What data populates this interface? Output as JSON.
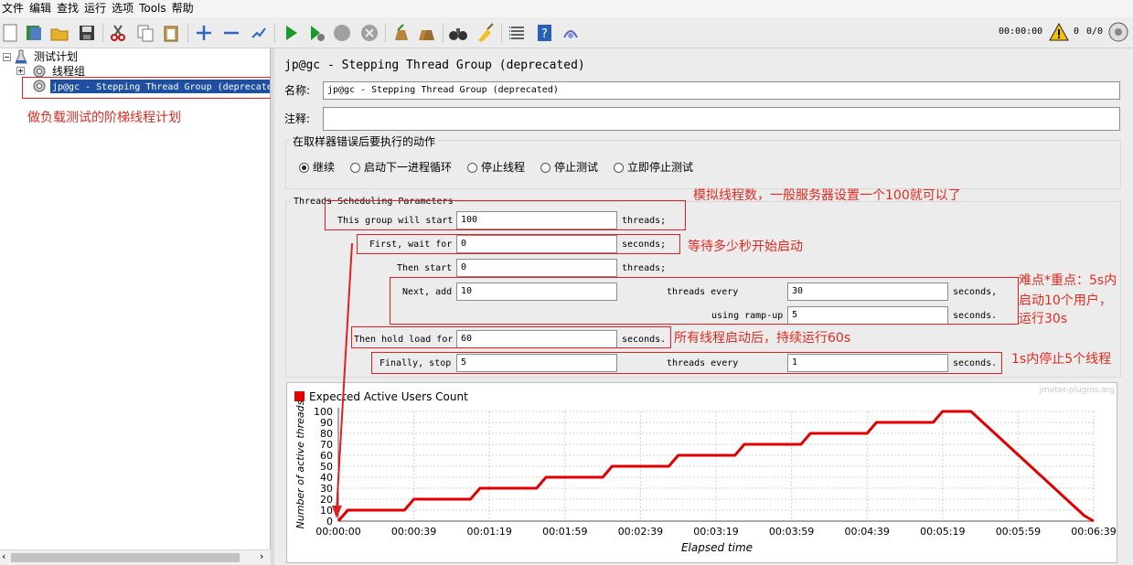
{
  "menu": [
    "文件",
    "编辑",
    "查找",
    "运行",
    "选项",
    "Tools",
    "帮助"
  ],
  "toolbar": {
    "timer": "00:00:00",
    "warning_count": "0",
    "threads_ratio": "0/0"
  },
  "tree": {
    "root": "测试计划",
    "group": "线程组",
    "selected": "jp@gc - Stepping Thread Group (deprecated)"
  },
  "panel": {
    "title": "jp@gc - Stepping Thread Group (deprecated)",
    "name_label": "名称:",
    "name_value": "jp@gc - Stepping Thread Group (deprecated)",
    "comment_label": "注释:",
    "comment_value": "",
    "error_group_title": "在取样器错误后要执行的动作",
    "error_actions": [
      {
        "label": "继续",
        "selected": true
      },
      {
        "label": "启动下一进程循环",
        "selected": false
      },
      {
        "label": "停止线程",
        "selected": false
      },
      {
        "label": "停止测试",
        "selected": false
      },
      {
        "label": "立即停止测试",
        "selected": false
      }
    ],
    "sched_title": "Threads Scheduling Parameters",
    "rows": {
      "start_label": "This group will start",
      "start_value": "100",
      "start_unit": "threads;",
      "wait_label": "First, wait for",
      "wait_value": "0",
      "wait_unit": "seconds;",
      "then_label": "Then start",
      "then_value": "0",
      "then_unit": "threads;",
      "next_label": "Next, add",
      "next_value": "10",
      "next_mid": "threads every",
      "next_every": "30",
      "next_unit": "seconds,",
      "ramp_label": "using ramp-up",
      "ramp_value": "5",
      "ramp_unit": "seconds.",
      "hold_label": "Then hold load for",
      "hold_value": "60",
      "hold_unit": "seconds.",
      "stop_label": "Finally, stop",
      "stop_value": "5",
      "stop_mid": "threads every",
      "stop_every": "1",
      "stop_unit": "seconds."
    }
  },
  "annotations": {
    "plan": "做负载测试的阶梯线程计划",
    "threads": "模拟线程数，一般服务器设置一个100就可以了",
    "wait": "等待多少秒开始启动",
    "key1": "难点*重点：5s内",
    "key2": "启动10个用户，",
    "key3": "运行30s",
    "hold": "所有线程启动后，持续运行60s",
    "stop": "1s内停止5个线程"
  },
  "colors": {
    "annotation": "#e02a1f",
    "series": "#e00000",
    "selection": "#1f4fa0"
  },
  "chart_data": {
    "type": "line",
    "watermark": "jmeter-plugins.org",
    "legend": "Expected Active Users Count",
    "legend_position": "top-left",
    "xlabel": "Elapsed time",
    "ylabel": "Number of active threads",
    "x_ticks": [
      "00:00:00",
      "00:00:39",
      "00:01:19",
      "00:01:59",
      "00:02:39",
      "00:03:19",
      "00:03:59",
      "00:04:39",
      "00:05:19",
      "00:05:59",
      "00:06:39"
    ],
    "y_ticks": [
      "0",
      "10",
      "20",
      "30",
      "40",
      "50",
      "60",
      "70",
      "80",
      "90",
      "100"
    ],
    "xlim": [
      0,
      400
    ],
    "ylim": [
      0,
      100
    ],
    "grid": true,
    "series": [
      {
        "x": [
          0,
          5,
          35,
          40,
          70,
          75,
          105,
          110,
          140,
          145,
          175,
          180,
          210,
          215,
          245,
          250,
          280,
          285,
          315,
          320,
          335,
          395,
          400
        ],
        "y": [
          0,
          10,
          10,
          20,
          20,
          30,
          30,
          40,
          40,
          50,
          50,
          60,
          60,
          70,
          70,
          80,
          80,
          90,
          90,
          100,
          100,
          5,
          0
        ]
      }
    ]
  }
}
